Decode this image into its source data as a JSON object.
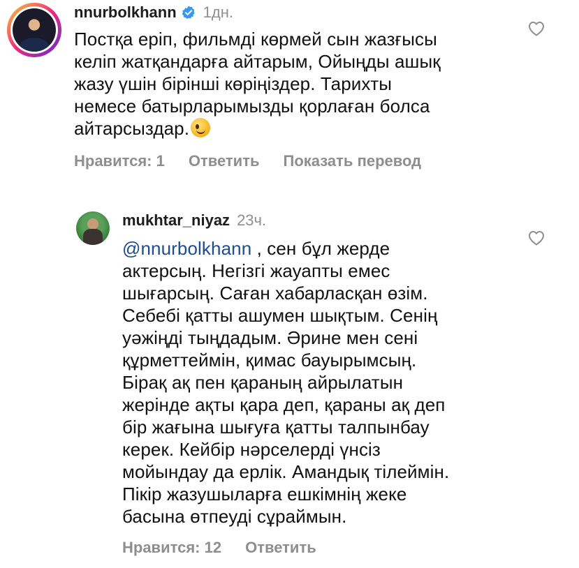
{
  "comments": [
    {
      "username": "nnurbolkhann",
      "verified": true,
      "time": "1дн.",
      "body_lines": [
        "Постқа еріп, фильмді көрмей сын жазғысы",
        "келіп жатқандарға айтарым, Ойыңды ашық",
        "жазу үшін бірінші көріңіздер. Тарихты",
        "немесе батырларымызды қорлаған болса",
        "айтарсыздар."
      ],
      "emoji": "wink-emoji",
      "likes_label": "Нравится: 1",
      "reply_label": "Ответить",
      "translate_label": "Показать перевод"
    },
    {
      "username": "mukhtar_niyaz",
      "verified": false,
      "time": "23ч.",
      "mention": "@nnurbolkhann",
      "body_lines": [
        " , сен бұл жерде",
        "актерсың. Негізгі жауапты емес",
        "шығарсың. Саған хабарласқан өзім.",
        "Себебі қатты ашумен шықтым. Сенің",
        "уәжіңді тыңдадым. Әрине мен сені",
        "құрметтеймін, қимас бауырымсың.",
        "Бірақ ақ пен қараның айрылатын",
        "жерінде ақты қара деп, қараны ақ деп",
        "бір жағына шығуға қатты талпынбау",
        "керек. Кейбір нәрселерді үнсіз",
        "мойындау да ерлік. Амандық тілеймін.",
        "Пікір жазушыларға ешкімнің жеке",
        "басына өтпеуді сұраймын."
      ],
      "likes_label": "Нравится: 12",
      "reply_label": "Ответить"
    }
  ],
  "colors": {
    "text": "#111111",
    "muted": "#8e8e8e",
    "mention": "#1f4b8f",
    "verified": "#3897f0"
  },
  "icons": {
    "like": "heart-outline-icon",
    "verified": "verified-badge-icon"
  }
}
